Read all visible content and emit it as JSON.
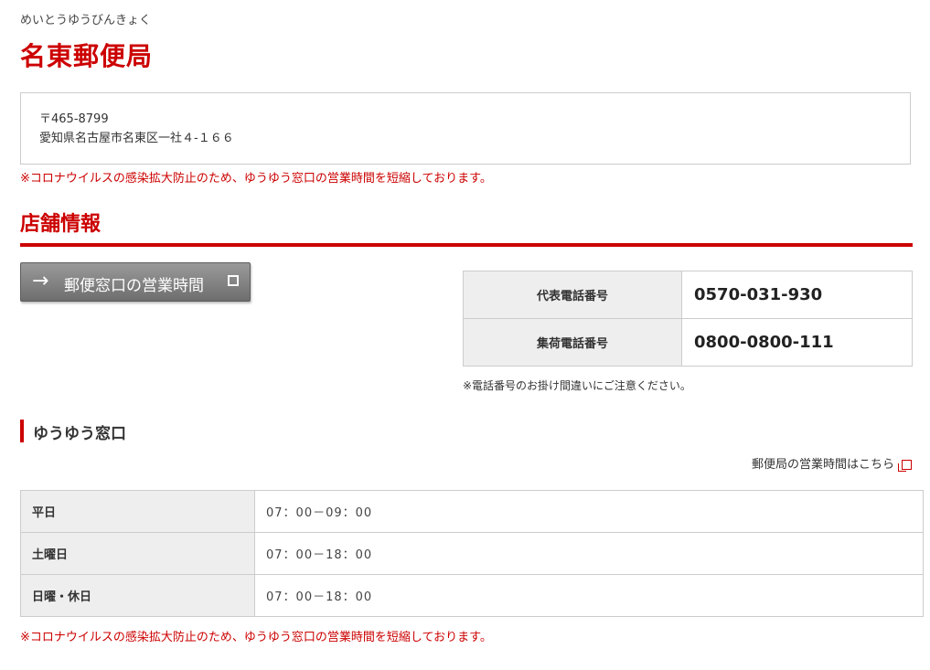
{
  "office": {
    "reading": "めいとうゆうびんきょく",
    "name": "名東郵便局",
    "postal_code": "〒465-8799",
    "address": "愛知県名古屋市名東区一社４-１６６",
    "notice_top": "※コロナウイルスの感染拡大防止のため、ゆうゆう窓口の営業時間を短縮しております。"
  },
  "store_info": {
    "title": "店舗情報",
    "hours_button_label": "郵便窓口の営業時間",
    "phones": [
      {
        "label": "代表電話番号",
        "number": "0570-031-930"
      },
      {
        "label": "集荷電話番号",
        "number": "0800-0800-111"
      }
    ],
    "phone_note": "※電話番号のお掛け間違いにご注意ください。"
  },
  "yuyu": {
    "title": "ゆうゆう窓口",
    "link_label": "郵便局の営業時間はこちら",
    "hours": [
      {
        "day": "平日",
        "time": "07：00－09：00"
      },
      {
        "day": "土曜日",
        "time": "07：00－18：00"
      },
      {
        "day": "日曜・休日",
        "time": "07：00－18：00"
      }
    ],
    "notice_bottom": "※コロナウイルスの感染拡大防止のため、ゆうゆう窓口の営業時間を短縮しております。"
  },
  "icons": {
    "button_arrow": "arrow-right-icon",
    "button_window": "window-icon",
    "external_link": "external-link-icon"
  },
  "colors": {
    "accent": "#cc0000",
    "header_cell_bg": "#eeeeee",
    "border": "#cccccc"
  }
}
